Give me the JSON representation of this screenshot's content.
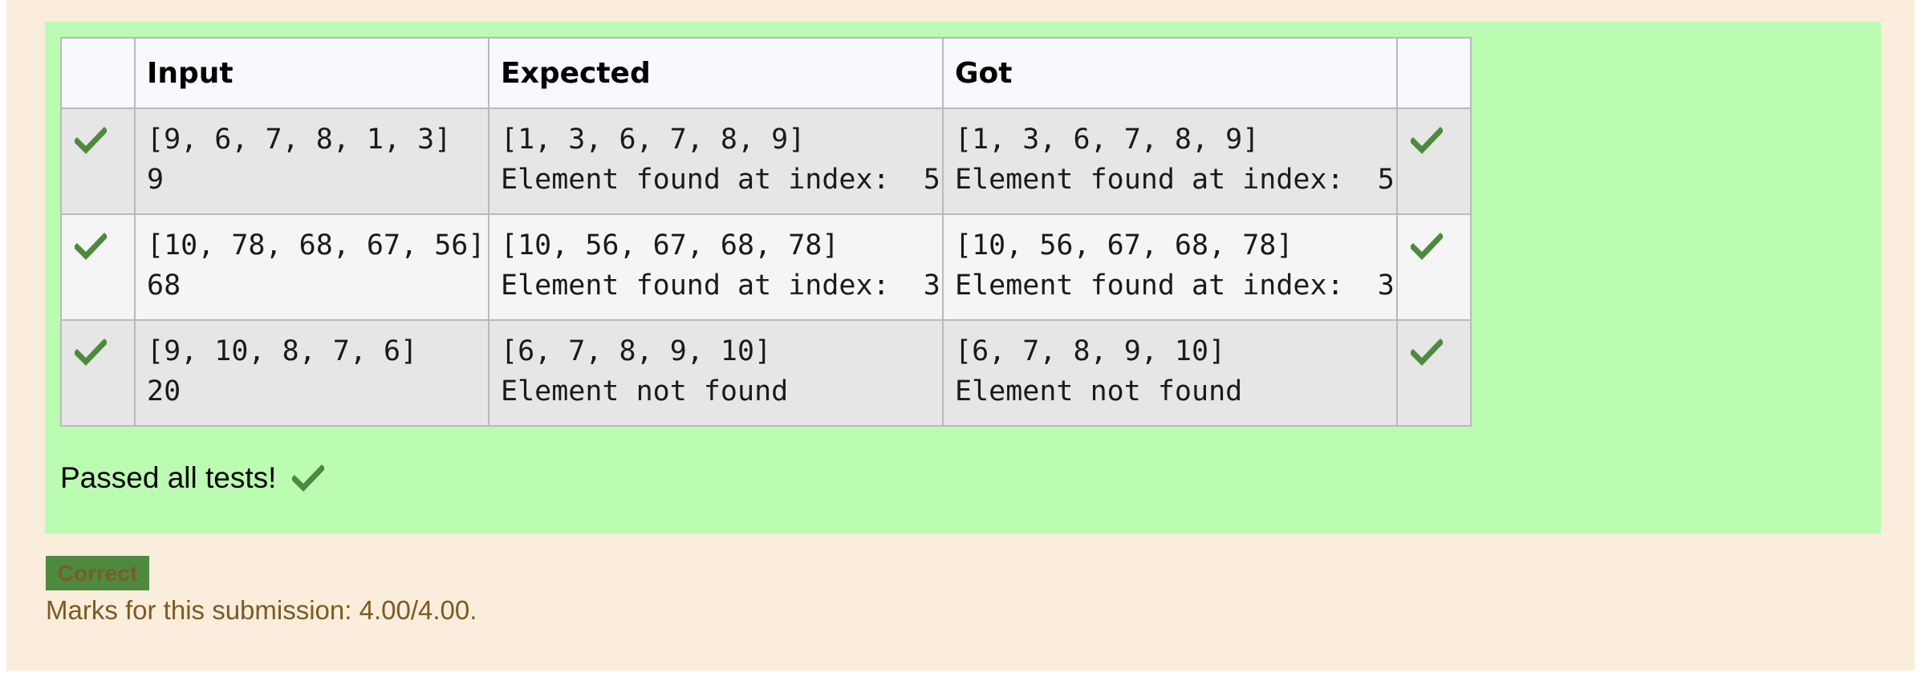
{
  "table": {
    "headers": [
      "",
      "Input",
      "Expected",
      "Got",
      ""
    ],
    "rows": [
      {
        "input": "[9, 6, 7, 8, 1, 3]\n9",
        "expected": "[1, 3, 6, 7, 8, 9]\nElement found at index:  5",
        "got": "[1, 3, 6, 7, 8, 9]\nElement found at index:  5",
        "status_icon": "check-icon"
      },
      {
        "input": "[10, 78, 68, 67, 56]\n68",
        "expected": "[10, 56, 67, 68, 78]\nElement found at index:  3",
        "got": "[10, 56, 67, 68, 78]\nElement found at index:  3",
        "status_icon": "check-icon"
      },
      {
        "input": "[9, 10, 8, 7, 6]\n20",
        "expected": "[6, 7, 8, 9, 10]\nElement not found",
        "got": "[6, 7, 8, 9, 10]\nElement not found",
        "status_icon": "check-icon"
      }
    ]
  },
  "summary": {
    "text": "Passed all tests!",
    "icon": "check-icon"
  },
  "grade": {
    "badge": "Correct",
    "marks": "Marks for this submission: 4.00/4.00."
  },
  "colors": {
    "page_background": "#faeddc",
    "results_background": "#bbfcb2",
    "check_green": "#4e8a3e",
    "badge_background": "#4e8a3e",
    "marks_text": "#7d5a22"
  }
}
